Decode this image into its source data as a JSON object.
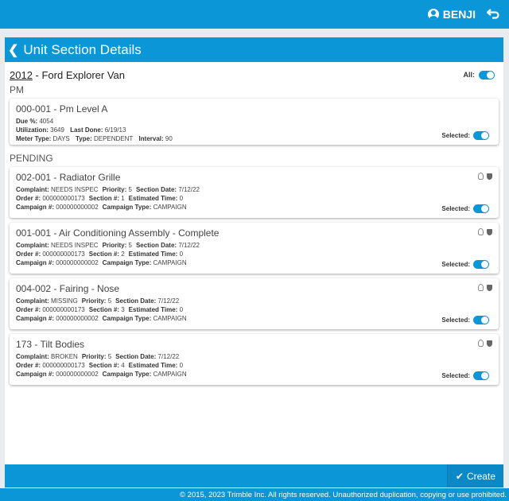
{
  "header": {
    "user_name": "BENJI"
  },
  "panel": {
    "title": "Unit Section Details",
    "vehicle_year": "2012",
    "vehicle_sep": " - ",
    "vehicle_name": "Ford Explorer Van",
    "all_label": "All:",
    "pm_label": "PM",
    "pending_label": "PENDING"
  },
  "pm_card": {
    "title": "000-001 - Pm Level A",
    "due_label": "Due %:",
    "due_value": "4054",
    "utilization_label": "Utilization:",
    "utilization_value": "3649",
    "last_done_label": "Last Done:",
    "last_done_value": "6/19/13",
    "meter_type_label": "Meter Type:",
    "meter_type_value": "DAYS",
    "type_label": "Type:",
    "type_value": "DEPENDENT",
    "interval_label": "Interval:",
    "interval_value": "90",
    "selected_label": "Selected:"
  },
  "labels": {
    "complaint": "Complaint:",
    "priority": "Priority:",
    "section_date": "Section Date:",
    "order": "Order #:",
    "section": "Section #:",
    "estimated_time": "Estimated Time:",
    "campaign": "Campaign #:",
    "campaign_type": "Campaign Type:",
    "selected": "Selected:"
  },
  "pending": [
    {
      "title": "002-001 - Radiator Grille",
      "complaint": "NEEDS INSPEC",
      "priority": "5",
      "section_date": "7/12/22",
      "order": "000000000173",
      "section": "1",
      "estimated_time": "0",
      "campaign": "000000000002",
      "campaign_type": "CAMPAIGN"
    },
    {
      "title": "001-001 - Air Conditioning Assembly - Complete",
      "complaint": "NEEDS INSPEC",
      "priority": "5",
      "section_date": "7/12/22",
      "order": "000000000173",
      "section": "2",
      "estimated_time": "0",
      "campaign": "000000000002",
      "campaign_type": "CAMPAIGN"
    },
    {
      "title": "004-002 - Fairing - Nose",
      "complaint": "MISSING",
      "priority": "5",
      "section_date": "7/12/22",
      "order": "000000000173",
      "section": "3",
      "estimated_time": "0",
      "campaign": "000000000002",
      "campaign_type": "CAMPAIGN"
    },
    {
      "title": "173 - Tilt Bodies",
      "complaint": "BROKEN",
      "priority": "5",
      "section_date": "7/12/22",
      "order": "000000000173",
      "section": "4",
      "estimated_time": "0",
      "campaign": "000000000002",
      "campaign_type": "CAMPAIGN"
    }
  ],
  "actions": {
    "create_label": "Create"
  },
  "footer": {
    "copyright": "© 2015, 2023 Trimble Inc. All rights reserved. Unauthorized duplication, copying or use prohibited."
  },
  "colors": {
    "accent": "#0b96d8"
  }
}
